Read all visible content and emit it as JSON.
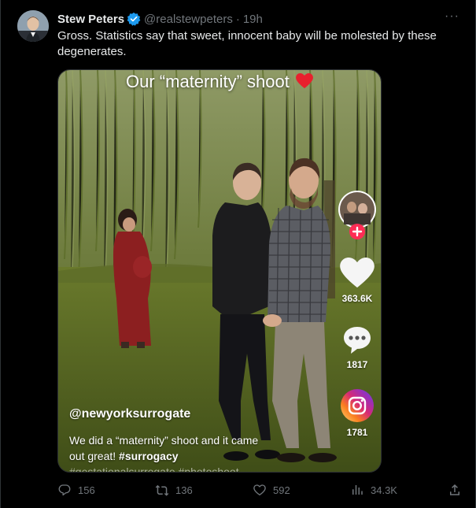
{
  "tweet": {
    "author_name": "Stew Peters",
    "handle": "@realstewpeters",
    "separator": "·",
    "time": "19h",
    "more_label": "···",
    "text": "Gross. Statistics say that sweet, innocent baby will be molested by these degenerates."
  },
  "media": {
    "title": "Our “maternity” shoot",
    "like_count": "363.6K",
    "comment_count": "1817",
    "share_count": "1781",
    "username": "@newyorksurrogate",
    "caption_line1": "We did a “maternity” shoot and it came",
    "caption_line2": "out great!",
    "caption_tag": "#surrogacy",
    "caption_line3": "#gestationalsurrogate #photoshoot"
  },
  "actions": {
    "replies": "156",
    "reposts": "136",
    "likes": "592",
    "views": "34.3K"
  },
  "colors": {
    "background": "#000000",
    "text": "#e7e9ea",
    "muted": "#71767b",
    "verified": "#1d9bf0",
    "tiktok_pink": "#fe2c55"
  },
  "icons": [
    "verified-badge-icon",
    "more-icon",
    "heart-emoji-icon",
    "follow-plus-icon",
    "tiktok-like-icon",
    "tiktok-comment-icon",
    "instagram-icon",
    "reply-icon",
    "repost-icon",
    "like-icon",
    "views-icon",
    "share-icon"
  ]
}
